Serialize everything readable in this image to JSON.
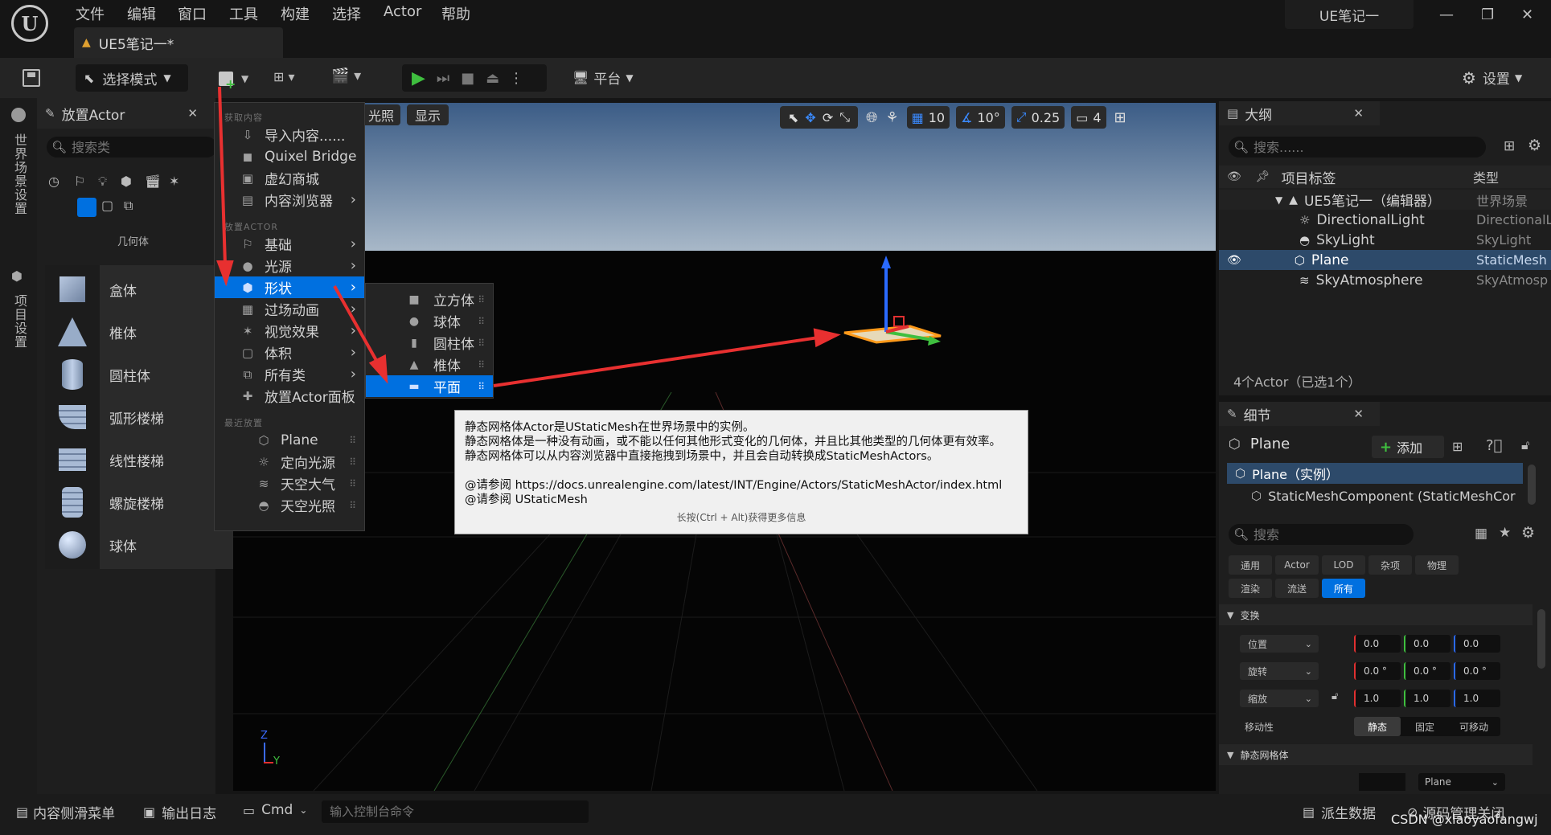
{
  "menu": [
    "文件",
    "编辑",
    "窗口",
    "工具",
    "构建",
    "选择",
    "Actor",
    "帮助"
  ],
  "document_tab": "UE5笔记一*",
  "project_name": "UE笔记一",
  "toolbar": {
    "select_mode": "选择模式",
    "platform": "平台",
    "settings": "设置"
  },
  "left_strip": {
    "world_settings": "世界场景设置",
    "project_settings": "项目设置"
  },
  "place_panel": {
    "title": "放置Actor",
    "search_placeholder": "搜索类",
    "category": "几何体",
    "items": [
      "盒体",
      "椎体",
      "圆柱体",
      "弧形楼梯",
      "线性楼梯",
      "螺旋楼梯",
      "球体"
    ]
  },
  "viewport": {
    "lighting": "光照",
    "show": "显示",
    "grid_size": "10",
    "angle_snap": "10°",
    "scale_snap": "0.25",
    "camera_speed": "4",
    "axis_z": "Z",
    "axis_y": "Y"
  },
  "context_menu": {
    "section_get": "获取内容",
    "import": "导入内容......",
    "quixel": "Quixel Bridge",
    "marketplace": "虚幻商城",
    "content_browser": "内容浏览器",
    "section_place": "放置ACTOR",
    "basic": "基础",
    "lights": "光源",
    "shapes": "形状",
    "cinematic": "过场动画",
    "visual_effects": "视觉效果",
    "volumes": "体积",
    "all_classes": "所有类",
    "place_actor_panel": "放置Actor面板",
    "section_recent": "最近放置",
    "recent": [
      "Plane",
      "定向光源",
      "天空大气",
      "天空光照"
    ]
  },
  "shapes_submenu": [
    "立方体",
    "球体",
    "圆柱体",
    "椎体",
    "平面"
  ],
  "tooltip": {
    "line1": "静态网格体Actor是UStaticMesh在世界场景中的实例。",
    "line2": "静态网格体是一种没有动画，或不能以任何其他形式变化的几何体，并且比其他类型的几何体更有效率。",
    "line3": "静态网格体可以从内容浏览器中直接拖拽到场景中，并且会自动转换成StaticMeshActors。",
    "line4": "@请参阅 https://docs.unrealengine.com/latest/INT/Engine/Actors/StaticMeshActor/index.html",
    "line5": "@请参阅 UStaticMesh",
    "footer": "长按(Ctrl + Alt)获得更多信息"
  },
  "outliner": {
    "title": "大纲",
    "search_placeholder": "搜索......",
    "col_label": "项目标签",
    "col_type": "类型",
    "rows": [
      {
        "label": "UE5笔记一（编辑器）",
        "type": "世界场景"
      },
      {
        "label": "DirectionalLight",
        "type": "DirectionalL"
      },
      {
        "label": "SkyLight",
        "type": "SkyLight"
      },
      {
        "label": "Plane",
        "type": "StaticMesh"
      },
      {
        "label": "SkyAtmosphere",
        "type": "SkyAtmosp"
      }
    ],
    "footer": "4个Actor（已选1个）"
  },
  "details": {
    "title": "细节",
    "actor_name": "Plane",
    "add": "添加",
    "instance": "Plane（实例）",
    "component": "StaticMeshComponent (StaticMeshCor",
    "search_placeholder": "搜索",
    "tabs_row1": [
      "通用",
      "Actor",
      "LOD",
      "杂项",
      "物理"
    ],
    "tabs_row2": [
      "渲染",
      "流送",
      "所有"
    ],
    "section_transform": "变换",
    "location": "位置",
    "rotation": "旋转",
    "scale": "缩放",
    "loc_values": [
      "0.0",
      "0.0",
      "0.0"
    ],
    "rot_values": [
      "0.0 °",
      "0.0 °",
      "0.0 °"
    ],
    "scale_values": [
      "1.0",
      "1.0",
      "1.0"
    ],
    "mobility": "移动性",
    "mobility_options": [
      "静态",
      "固定",
      "可移动"
    ],
    "section_mesh": "静态网格体",
    "mesh_value": "Plane"
  },
  "bottombar": {
    "content_drawer": "内容侧滑菜单",
    "output_log": "输出日志",
    "cmd": "Cmd",
    "console_placeholder": "输入控制台命令",
    "derived_data": "派生数据",
    "source_control": "源码管理关闭",
    "watermark": "CSDN @xiaoyaofangwj"
  },
  "colors": {
    "accent": "#0070e0",
    "play_green": "#3fbf3f",
    "arrow_red": "#e83030"
  }
}
